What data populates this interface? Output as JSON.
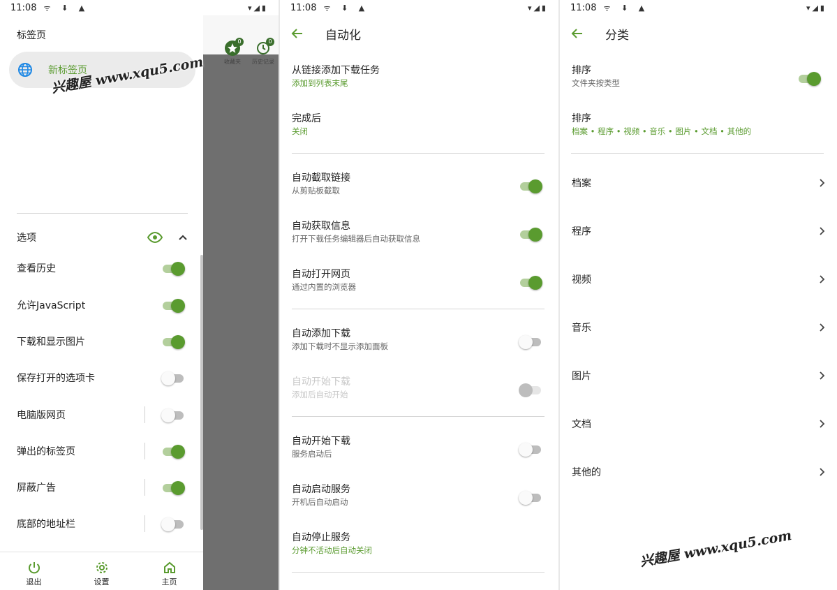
{
  "status_bar": {
    "time": "11:08"
  },
  "colors": {
    "accent": "#5a9b2f",
    "accent_light": "#b3cf9c",
    "scrim": "#6f6f6f"
  },
  "panel1": {
    "drawer_title": "标签页",
    "new_tab_label": "新标签页",
    "behind_toolbar": [
      {
        "label": "收藏夹",
        "badge": "0",
        "icon": "star-icon"
      },
      {
        "label": "历史记录",
        "badge": "0",
        "icon": "clock-icon"
      }
    ],
    "options_header": "选项",
    "options": [
      {
        "label": "查看历史",
        "on": true
      },
      {
        "label": "允许JavaScript",
        "on": true
      },
      {
        "label": "下载和显示图片",
        "on": true
      },
      {
        "label": "保存打开的选项卡",
        "on": false
      },
      {
        "label": "电脑版网页",
        "on": false
      },
      {
        "label": "弹出的标签页",
        "on": true
      },
      {
        "label": "屏蔽广告",
        "on": true
      },
      {
        "label": "底部的地址栏",
        "on": false
      }
    ],
    "bottom_nav": [
      {
        "label": "退出",
        "icon": "power-icon"
      },
      {
        "label": "设置",
        "icon": "gear-icon"
      },
      {
        "label": "主页",
        "icon": "home-icon"
      }
    ]
  },
  "panel2": {
    "title": "自动化",
    "rows": [
      {
        "title": "从链接添加下载任务",
        "sub": "添加到列表末尾",
        "sub_accent": true,
        "switch": null
      },
      {
        "title": "完成后",
        "sub": "关闭",
        "sub_accent": true,
        "switch": null
      },
      {
        "title": "自动截取链接",
        "sub": "从剪贴板截取",
        "switch": "on"
      },
      {
        "title": "自动获取信息",
        "sub": "打开下载任务编辑器后自动获取信息",
        "switch": "on"
      },
      {
        "title": "自动打开网页",
        "sub": "通过内置的浏览器",
        "switch": "on"
      },
      {
        "title": "自动添加下载",
        "sub": "添加下载时不显示添加面板",
        "switch": "off"
      },
      {
        "title": "自动开始下载",
        "sub": "添加后自动开始",
        "switch": "disabled"
      },
      {
        "title": "自动开始下载",
        "sub": "服务启动后",
        "switch": "off"
      },
      {
        "title": "自动启动服务",
        "sub": "开机后自动启动",
        "switch": "off"
      },
      {
        "title": "自动停止服务",
        "sub": "分钟不活动后自动关闭",
        "sub_accent": true,
        "switch": null
      }
    ]
  },
  "panel3": {
    "title": "分类",
    "sort_rows": [
      {
        "title": "排序",
        "sub": "文件夹按类型",
        "sub_accent": false,
        "switch": "on"
      },
      {
        "title": "排序",
        "sub": "档案 • 程序 • 视频 • 音乐 • 图片 • 文档 • 其他的",
        "sub_accent": true,
        "switch": null
      }
    ],
    "categories": [
      "档案",
      "程序",
      "视频",
      "音乐",
      "图片",
      "文档",
      "其他的"
    ]
  },
  "watermark": "兴趣屋 www.xqu5.com"
}
